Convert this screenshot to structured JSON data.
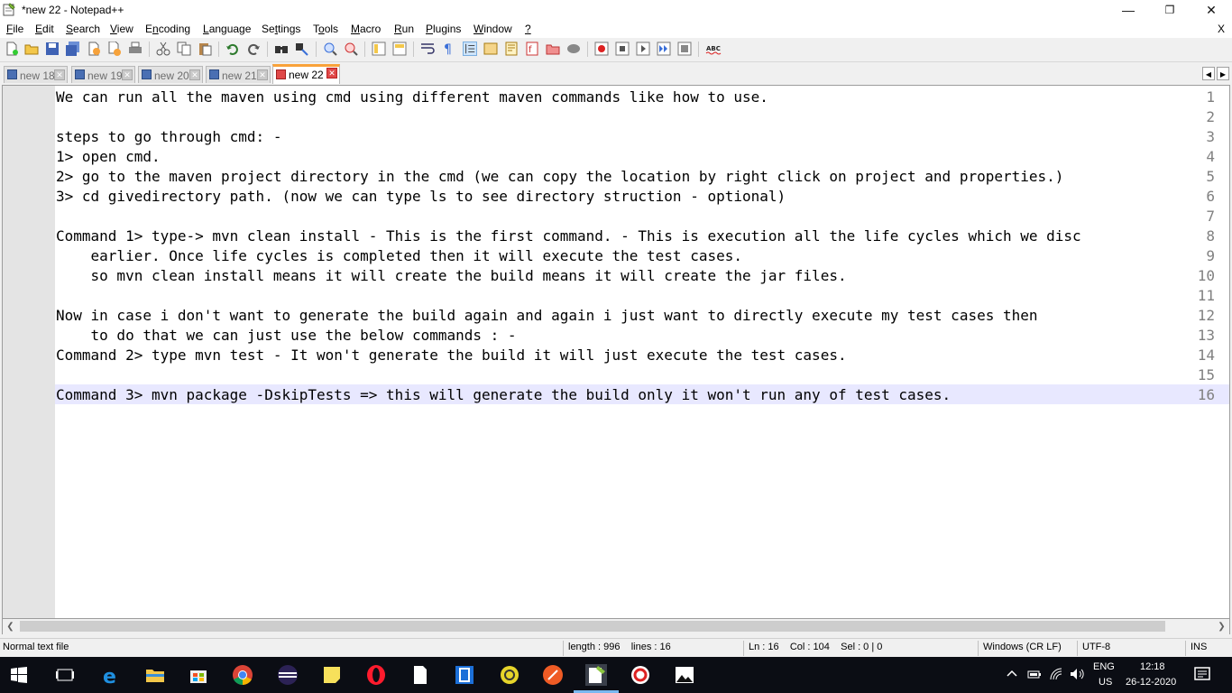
{
  "window": {
    "title": "*new 22 - Notepad++",
    "controls": {
      "minimize": "—",
      "maximize": "❐",
      "close": "✕"
    }
  },
  "menu": {
    "items": [
      {
        "label": "File",
        "u": "F",
        "rest": "ile"
      },
      {
        "label": "Edit",
        "u": "E",
        "rest": "dit"
      },
      {
        "label": "Search",
        "u": "S",
        "rest": "earch"
      },
      {
        "label": "View",
        "u": "V",
        "rest": "iew"
      },
      {
        "label": "Encoding",
        "u": "n",
        "pre": "E",
        "rest": "coding"
      },
      {
        "label": "Language",
        "u": "L",
        "rest": "anguage"
      },
      {
        "label": "Settings",
        "u": "t",
        "pre": "Se",
        "rest": "tings"
      },
      {
        "label": "Tools",
        "u": "o",
        "pre": "T",
        "rest": "ols"
      },
      {
        "label": "Macro",
        "u": "M",
        "rest": "acro"
      },
      {
        "label": "Run",
        "u": "R",
        "rest": "un"
      },
      {
        "label": "Plugins",
        "u": "P",
        "rest": "lugins"
      },
      {
        "label": "Window",
        "u": "W",
        "rest": "indow"
      },
      {
        "label": "?",
        "u": "?",
        "rest": ""
      }
    ],
    "close_doc": "X"
  },
  "tabs": [
    {
      "label": "new 18",
      "active": false
    },
    {
      "label": "new 19",
      "active": false
    },
    {
      "label": "new 20",
      "active": false
    },
    {
      "label": "new 21",
      "active": false
    },
    {
      "label": "new 22",
      "active": true
    }
  ],
  "tab_close_glyph": "✕",
  "tab_scroll": {
    "left": "◀",
    "right": "▶"
  },
  "toolbar": {
    "spellcheck_label": "ABC"
  },
  "editor": {
    "current_line": 16,
    "lines": [
      {
        "n": "1",
        "text": "We can run all the maven using cmd using different maven commands like how to use."
      },
      {
        "n": "2",
        "text": ""
      },
      {
        "n": "3",
        "text": "steps to go through cmd: -"
      },
      {
        "n": "4",
        "text": "1> open cmd."
      },
      {
        "n": "5",
        "text": "2> go to the maven project directory in the cmd (we can copy the location by right click on project and properties.)"
      },
      {
        "n": "6",
        "text": "3> cd givedirectory path. (now we can type ls to see directory struction - optional)"
      },
      {
        "n": "7",
        "text": ""
      },
      {
        "n": "8",
        "text": "Command 1> type-> mvn clean install - This is the first command. - This is execution all the life cycles which we disc"
      },
      {
        "n": "9",
        "text": "    earlier. Once life cycles is completed then it will execute the test cases."
      },
      {
        "n": "10",
        "text": "    so mvn clean install means it will create the build means it will create the jar files."
      },
      {
        "n": "11",
        "text": ""
      },
      {
        "n": "12",
        "text": "Now in case i don't want to generate the build again and again i just want to directly execute my test cases then"
      },
      {
        "n": "13",
        "text": "    to do that we can just use the below commands : -"
      },
      {
        "n": "14",
        "text": "Command 2> type mvn test - It won't generate the build it will just execute the test cases."
      },
      {
        "n": "15",
        "text": ""
      },
      {
        "n": "16",
        "text": "Command 3> mvn package -DskipTests => this will generate the build only it won't run any of test cases."
      }
    ]
  },
  "hscroll": {
    "left": "❮",
    "right": "❯"
  },
  "status": {
    "file_type": "Normal text file",
    "length": "length : 996    lines : 16",
    "position": "Ln : 16    Col : 104    Sel : 0 | 0",
    "eol": "Windows (CR LF)",
    "encoding": "UTF-8",
    "mode": "INS"
  },
  "taskbar": {
    "lang_top": "ENG",
    "lang_bottom": "US",
    "time": "12:18",
    "date": "26-12-2020"
  },
  "colors": {
    "accent_tab": "#f9a23a",
    "current_line": "#e8e8ff",
    "gutter": "#e4e4e4",
    "taskbar": "#0b0d14"
  }
}
